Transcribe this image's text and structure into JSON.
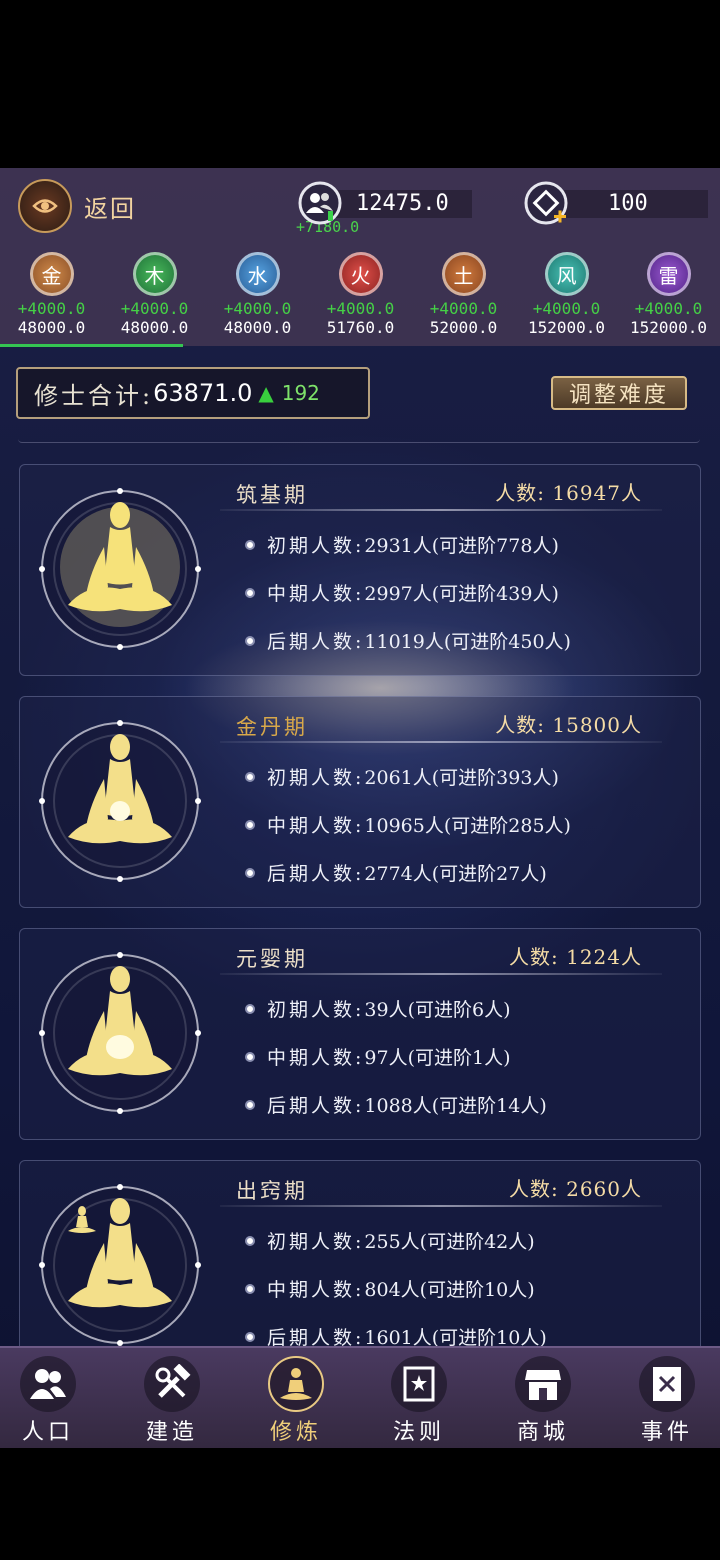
{
  "header": {
    "back_label": "返回",
    "population_value": "12475.0",
    "population_gain": "+7180.0",
    "gems_value": "100"
  },
  "elements": [
    {
      "name": "金",
      "inc": "+4000.0",
      "total": "48000.0",
      "color": "#b0743e"
    },
    {
      "name": "木",
      "inc": "+4000.0",
      "total": "48000.0",
      "color": "#2f9a46"
    },
    {
      "name": "水",
      "inc": "+4000.0",
      "total": "48000.0",
      "color": "#3a86c8"
    },
    {
      "name": "火",
      "inc": "+4000.0",
      "total": "51760.0",
      "color": "#c43a36"
    },
    {
      "name": "土",
      "inc": "+4000.0",
      "total": "52000.0",
      "color": "#b8662e"
    },
    {
      "name": "风",
      "inc": "+4000.0",
      "total": "152000.0",
      "color": "#2fa39a"
    },
    {
      "name": "雷",
      "inc": "+4000.0",
      "total": "152000.0",
      "color": "#7b3fb0"
    }
  ],
  "summary": {
    "label": "修士合计:",
    "total": "63871.0",
    "increase": "192",
    "adjust_label": "调整难度"
  },
  "stages": [
    {
      "title": "筑基期",
      "count": "人数: 16947人",
      "rows": [
        {
          "label": "初期人数:",
          "value": "2931人(可进阶778人)"
        },
        {
          "label": "中期人数:",
          "value": "2997人(可进阶439人)"
        },
        {
          "label": "后期人数:",
          "value": "11019人(可进阶450人)"
        }
      ]
    },
    {
      "title": "金丹期",
      "count": "人数: 15800人",
      "rows": [
        {
          "label": "初期人数:",
          "value": "2061人(可进阶393人)"
        },
        {
          "label": "中期人数:",
          "value": "10965人(可进阶285人)"
        },
        {
          "label": "后期人数:",
          "value": "2774人(可进阶27人)"
        }
      ]
    },
    {
      "title": "元婴期",
      "count": "人数: 1224人",
      "rows": [
        {
          "label": "初期人数:",
          "value": "39人(可进阶6人)"
        },
        {
          "label": "中期人数:",
          "value": "97人(可进阶1人)"
        },
        {
          "label": "后期人数:",
          "value": "1088人(可进阶14人)"
        }
      ]
    },
    {
      "title": "出窍期",
      "count": "人数: 2660人",
      "rows": [
        {
          "label": "初期人数:",
          "value": "255人(可进阶42人)"
        },
        {
          "label": "中期人数:",
          "value": "804人(可进阶10人)"
        },
        {
          "label": "后期人数:",
          "value": "1601人(可进阶10人)"
        }
      ]
    }
  ],
  "nav": [
    {
      "label": "人口",
      "icon": "people-icon"
    },
    {
      "label": "建造",
      "icon": "tools-icon"
    },
    {
      "label": "修炼",
      "icon": "meditation-icon",
      "active": true
    },
    {
      "label": "法则",
      "icon": "law-book-icon"
    },
    {
      "label": "商城",
      "icon": "shop-icon"
    },
    {
      "label": "事件",
      "icon": "event-book-icon"
    }
  ]
}
